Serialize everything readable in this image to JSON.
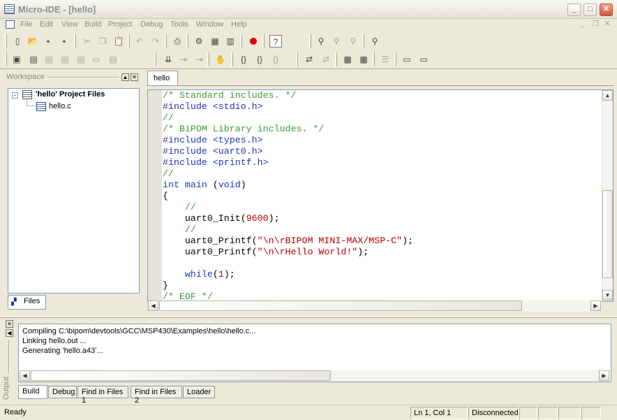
{
  "window": {
    "title": "Micro-IDE - [hello]"
  },
  "menu": [
    "File",
    "Edit",
    "View",
    "Build",
    "Project",
    "Debug",
    "Tools",
    "Window",
    "Help"
  ],
  "toolbar1": [
    {
      "icon": "new-file-icon",
      "glyph": "▯"
    },
    {
      "icon": "open-folder-icon",
      "glyph": "📂"
    },
    {
      "icon": "save-icon",
      "glyph": "▪"
    },
    {
      "icon": "save-all-icon",
      "glyph": "▪"
    },
    {
      "icon": "cut-icon",
      "glyph": "✂"
    },
    {
      "icon": "copy-icon",
      "glyph": "❐"
    },
    {
      "icon": "paste-icon",
      "glyph": "📋"
    },
    {
      "icon": "undo-icon",
      "glyph": "↶"
    },
    {
      "icon": "redo-icon",
      "glyph": "↷"
    },
    {
      "icon": "print-icon",
      "glyph": "⎙"
    },
    {
      "icon": "compile-icon",
      "glyph": "⚙"
    },
    {
      "icon": "build-icon",
      "glyph": "▦"
    },
    {
      "icon": "rebuild-icon",
      "glyph": "▥"
    },
    {
      "icon": "breakpoint-icon",
      "glyph": ""
    },
    {
      "icon": "help-icon",
      "glyph": "?"
    },
    {
      "icon": "find-icon",
      "glyph": "⚲"
    },
    {
      "icon": "find-next-icon",
      "glyph": "⚲"
    },
    {
      "icon": "find-prev-icon",
      "glyph": "⚲"
    },
    {
      "icon": "find-in-files-icon",
      "glyph": "⚲"
    }
  ],
  "toolbar2": [
    {
      "icon": "workspace-toggle-icon",
      "glyph": "▣"
    },
    {
      "icon": "output-toggle-icon",
      "glyph": "▤"
    },
    {
      "icon": "watch-icon",
      "glyph": "▤"
    },
    {
      "icon": "registers-icon",
      "glyph": "▤"
    },
    {
      "icon": "memory-icon",
      "glyph": "▤"
    },
    {
      "icon": "terminal-icon",
      "glyph": "▭"
    },
    {
      "icon": "disassembly-icon",
      "glyph": "▤"
    },
    {
      "icon": "download-icon",
      "glyph": "⇊"
    },
    {
      "icon": "step-into-icon",
      "glyph": "⇥"
    },
    {
      "icon": "step-over-icon",
      "glyph": "⇥"
    },
    {
      "icon": "stop-hand-icon",
      "glyph": "✋"
    },
    {
      "icon": "run-to-cursor-icon",
      "glyph": "{}"
    },
    {
      "icon": "step-out-icon",
      "glyph": "{}"
    },
    {
      "icon": "go-icon",
      "glyph": "{}"
    },
    {
      "icon": "connect-icon",
      "glyph": "⇄"
    },
    {
      "icon": "disconnect-icon",
      "glyph": "⇄"
    },
    {
      "icon": "board-icon",
      "glyph": "▦"
    },
    {
      "icon": "reset-icon",
      "glyph": "▦"
    },
    {
      "icon": "settings-icon",
      "glyph": "☰"
    },
    {
      "icon": "monitor-icon",
      "glyph": "▭"
    },
    {
      "icon": "screen-icon",
      "glyph": "▭"
    }
  ],
  "workspace": {
    "title": "Workspace",
    "project": "'hello' Project Files",
    "file": "hello.c",
    "tab": "Files"
  },
  "editor": {
    "tab": "hello",
    "lines": [
      [
        [
          "cm",
          "/* Standard includes. */"
        ]
      ],
      [
        [
          "kw",
          "#include <stdio.h>"
        ]
      ],
      [
        [
          "cm",
          "//"
        ]
      ],
      [
        [
          "cm",
          "/* BiPOM Library includes. */"
        ]
      ],
      [
        [
          "kw",
          "#include <types.h>"
        ]
      ],
      [
        [
          "kw",
          "#include <uart0.h>"
        ]
      ],
      [
        [
          "kw",
          "#include <printf.h>"
        ]
      ],
      [
        [
          "cm",
          "//"
        ]
      ],
      [
        [
          "kw",
          "int main "
        ],
        [
          "nm",
          "("
        ],
        [
          "kw",
          "void"
        ],
        [
          "nm",
          ")"
        ]
      ],
      [
        [
          "nm",
          "{"
        ]
      ],
      [
        [
          "cm",
          "    //"
        ]
      ],
      [
        [
          "nm",
          "    uart0_Init("
        ],
        [
          "num",
          "9600"
        ],
        [
          "nm",
          ");"
        ]
      ],
      [
        [
          "cm",
          "    //"
        ]
      ],
      [
        [
          "nm",
          "    uart0_Printf("
        ],
        [
          "str",
          "\"\\n\\rBIPOM MINI-MAX/MSP-C\""
        ],
        [
          "nm",
          ");"
        ]
      ],
      [
        [
          "nm",
          "    uart0_Printf("
        ],
        [
          "str",
          "\"\\n\\rHello World!\""
        ],
        [
          "nm",
          ");"
        ]
      ],
      [
        [
          "nm",
          ""
        ]
      ],
      [
        [
          "kw",
          "    while"
        ],
        [
          "nm",
          "("
        ],
        [
          "num",
          "1"
        ],
        [
          "nm",
          ");"
        ]
      ],
      [
        [
          "nm",
          "}"
        ]
      ],
      [
        [
          "cm",
          "/* EOF */"
        ]
      ]
    ]
  },
  "output": {
    "title": "Output",
    "lines": [
      "Compiling C:\\bipom\\devtools\\GCC\\MSP430\\Examples\\hello\\hello.c...",
      "Linking hello.out ...",
      "Generating 'hello.a43'..."
    ],
    "tabs": [
      "Build",
      "Debug",
      "Find in Files 1",
      "Find in Files 2",
      "Loader"
    ]
  },
  "status": {
    "text": "Ready",
    "position": "Ln 1, Col 1",
    "connection": "Disconnected"
  }
}
